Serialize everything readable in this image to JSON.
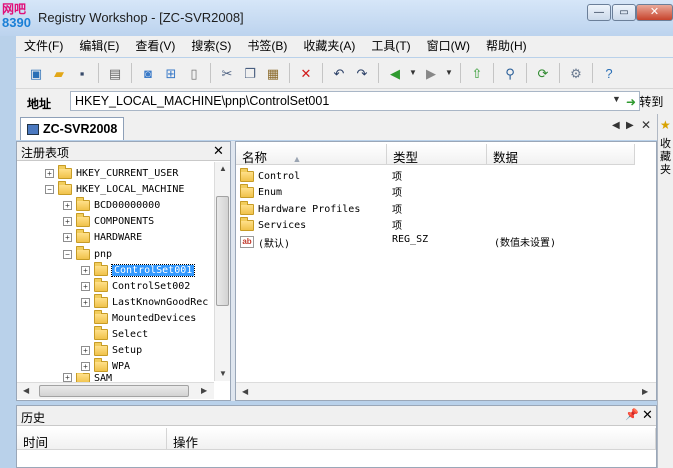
{
  "window": {
    "title": "Registry Workshop - [ZC-SVR2008]",
    "watermark_line1": "网吧",
    "watermark_line2": "8390"
  },
  "menu": [
    "文件(F)",
    "编辑(E)",
    "查看(V)",
    "搜索(S)",
    "书签(B)",
    "收藏夹(A)",
    "工具(T)",
    "窗口(W)",
    "帮助(H)"
  ],
  "address": {
    "label": "地址",
    "value": "HKEY_LOCAL_MACHINE\\pnp\\ControlSet001",
    "go_label": "转到"
  },
  "tab": {
    "label": "ZC-SVR2008"
  },
  "side_panel": {
    "label": "收藏夹"
  },
  "tree": {
    "header": "注册表项",
    "nodes": [
      {
        "label": "HKEY_CURRENT_USER",
        "depth": 1,
        "expander": "+"
      },
      {
        "label": "HKEY_LOCAL_MACHINE",
        "depth": 1,
        "expander": "−"
      },
      {
        "label": "BCD00000000",
        "depth": 2,
        "expander": "+"
      },
      {
        "label": "COMPONENTS",
        "depth": 2,
        "expander": "+"
      },
      {
        "label": "HARDWARE",
        "depth": 2,
        "expander": "+"
      },
      {
        "label": "pnp",
        "depth": 2,
        "expander": "−"
      },
      {
        "label": "ControlSet001",
        "depth": 3,
        "expander": "+",
        "selected": true
      },
      {
        "label": "ControlSet002",
        "depth": 3,
        "expander": "+"
      },
      {
        "label": "LastKnownGoodRec",
        "depth": 3,
        "expander": "+"
      },
      {
        "label": "MountedDevices",
        "depth": 3,
        "expander": ""
      },
      {
        "label": "Select",
        "depth": 3,
        "expander": ""
      },
      {
        "label": "Setup",
        "depth": 3,
        "expander": "+"
      },
      {
        "label": "WPA",
        "depth": 3,
        "expander": "+"
      },
      {
        "label": "SAM",
        "depth": 2,
        "expander": "+"
      }
    ]
  },
  "list": {
    "columns": [
      "名称",
      "类型",
      "数据"
    ],
    "rows": [
      {
        "name": "Control",
        "type": "项",
        "data": "",
        "icon": "folder-icon"
      },
      {
        "name": "Enum",
        "type": "项",
        "data": "",
        "icon": "folder-icon"
      },
      {
        "name": "Hardware Profiles",
        "type": "项",
        "data": "",
        "icon": "folder-icon"
      },
      {
        "name": "Services",
        "type": "项",
        "data": "",
        "icon": "folder-icon"
      },
      {
        "name": "(默认)",
        "type": "REG_SZ",
        "data": "(数值未设置)",
        "icon": "string-value-icon"
      }
    ]
  },
  "history": {
    "header": "历史",
    "columns": [
      "时间",
      "操作"
    ]
  },
  "colors": {
    "frame": "#b9d1ea",
    "selection": "#3399ff",
    "chrome": "#f0f0f0"
  }
}
